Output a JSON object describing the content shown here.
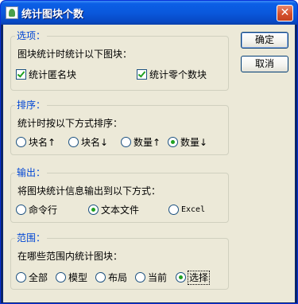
{
  "window": {
    "title": "统计图块个数",
    "close_glyph": "✕"
  },
  "buttons": {
    "ok": "确定",
    "cancel": "取消"
  },
  "options_group": {
    "label": "选项：",
    "desc": "图块统计时统计以下图块：",
    "checkboxes": [
      {
        "label": "统计匿名块",
        "checked": true
      },
      {
        "label": "统计零个数块",
        "checked": true
      }
    ]
  },
  "sort_group": {
    "label": "排序：",
    "desc": "统计时按以下方式排序：",
    "radios": [
      {
        "label": "块名↑",
        "checked": false
      },
      {
        "label": "块名↓",
        "checked": false
      },
      {
        "label": "数量↑",
        "checked": false
      },
      {
        "label": "数量↓",
        "checked": true
      }
    ]
  },
  "output_group": {
    "label": "输出：",
    "desc": "将图块统计信息输出到以下方式：",
    "radios": [
      {
        "label": "命令行",
        "checked": false
      },
      {
        "label": "文本文件",
        "checked": true
      },
      {
        "label": "Excel",
        "checked": false
      }
    ]
  },
  "scope_group": {
    "label": "范围：",
    "desc": "在哪些范围内统计图块：",
    "radios": [
      {
        "label": "全部",
        "checked": false
      },
      {
        "label": "模型",
        "checked": false
      },
      {
        "label": "布局",
        "checked": false
      },
      {
        "label": "当前",
        "checked": false
      },
      {
        "label": "选择",
        "checked": true
      }
    ]
  },
  "colors": {
    "title_bar": "#0a58dc",
    "dialog_bg": "#ece9d8",
    "group_label": "#0046d5",
    "check_mark": "#21a121"
  }
}
